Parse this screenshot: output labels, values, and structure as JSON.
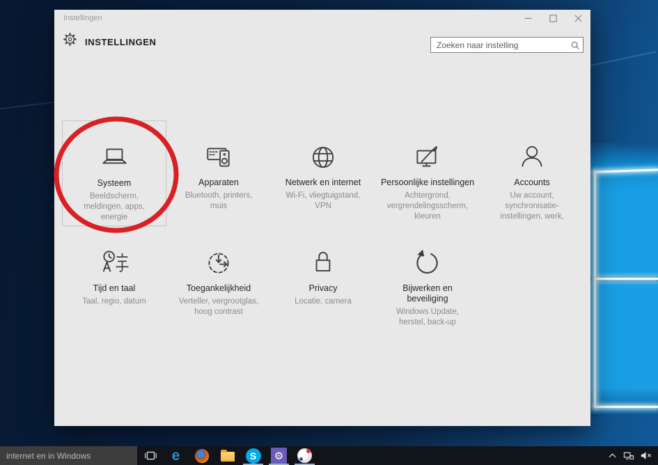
{
  "window": {
    "titlebar": {
      "title": "Instellingen"
    },
    "header": {
      "app_title": "INSTELLINGEN"
    },
    "search": {
      "placeholder": "Zoeken naar instelling",
      "icon": "search-icon"
    },
    "controls": [
      "minimize-icon",
      "maximize-icon",
      "close-icon"
    ],
    "tiles": [
      {
        "title": "Systeem",
        "subtitle": "Beeldscherm,\nmeldingen, apps,\nenergie",
        "icon": "laptop-icon",
        "highlighted": true
      },
      {
        "title": "Apparaten",
        "subtitle": "Bluetooth, printers,\nmuis",
        "icon": "devices-icon"
      },
      {
        "title": "Netwerk en internet",
        "subtitle": "Wi-Fi, vliegtuigstand,\nVPN",
        "icon": "globe-icon"
      },
      {
        "title": "Persoonlijke instellingen",
        "subtitle": "Achtergrond,\nvergrendelingsscherm,\nkleuren",
        "icon": "personalization-icon"
      },
      {
        "title": "Accounts",
        "subtitle": "Uw account,\nsynchronisatie-\ninstellingen, werk,",
        "icon": "person-icon"
      },
      {
        "title": "Tijd en taal",
        "subtitle": "Taal, regio, datum",
        "icon": "time-language-icon"
      },
      {
        "title": "Toegankelijkheid",
        "subtitle": "Verteller, vergrootglas,\nhoog contrast",
        "icon": "ease-of-access-icon"
      },
      {
        "title": "Privacy",
        "subtitle": "Locatie, camera",
        "icon": "lock-icon"
      },
      {
        "title": "Bijwerken en\nbeveiliging",
        "subtitle": "Windows Update,\nherstel, back-up",
        "icon": "update-refresh-icon"
      }
    ]
  },
  "annotation": {
    "shape": "ellipse",
    "color": "#d92025",
    "target": "Systeem"
  },
  "taskbar": {
    "search_text": "internet en in Windows",
    "apps": [
      {
        "name": "task-view-icon",
        "running": false
      },
      {
        "name": "edge-icon",
        "running": false,
        "glyph": "e"
      },
      {
        "name": "firefox-icon",
        "running": false
      },
      {
        "name": "file-explorer-icon",
        "running": false
      },
      {
        "name": "skype-icon",
        "running": true,
        "glyph": "S"
      },
      {
        "name": "settings-icon",
        "running": true,
        "glyph": "⚙"
      },
      {
        "name": "paint-icon",
        "running": true
      }
    ],
    "tray": [
      "show-hidden-icons-chevron",
      "network-icon",
      "volume-muted-icon"
    ]
  }
}
